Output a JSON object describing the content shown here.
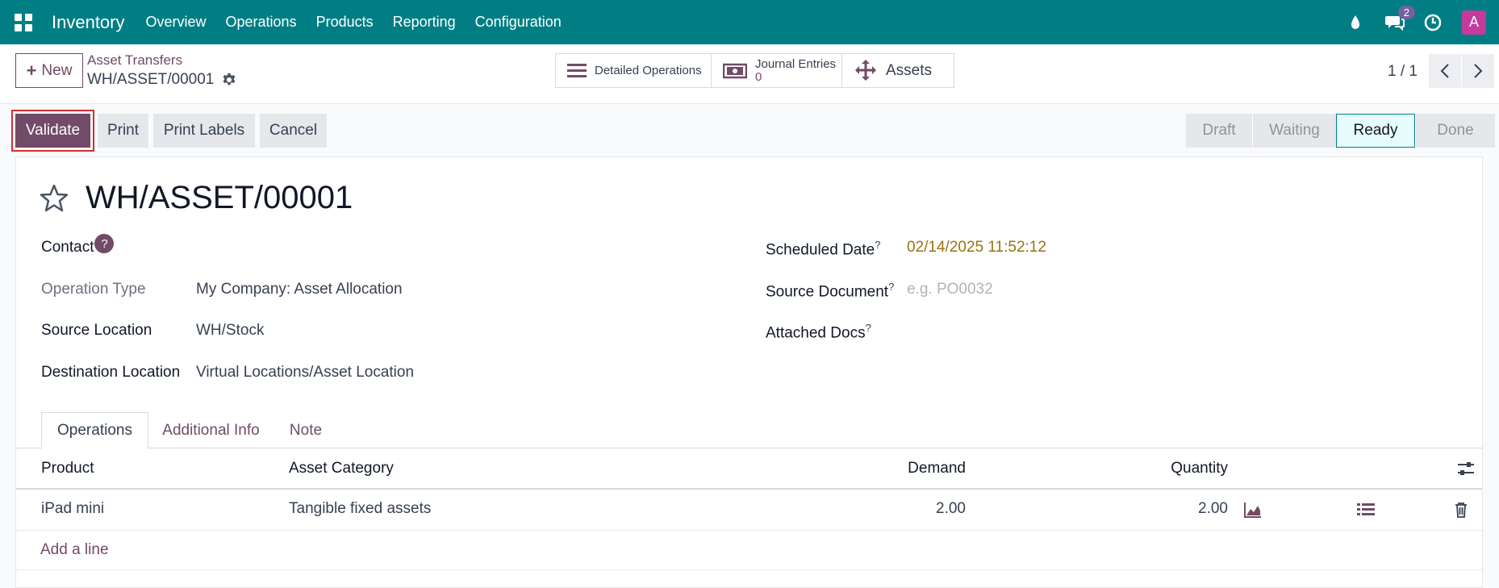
{
  "navbar": {
    "brand": "Inventory",
    "menu": [
      "Overview",
      "Operations",
      "Products",
      "Reporting",
      "Configuration"
    ],
    "messages_count": "2",
    "avatar_letter": "A",
    "icons": [
      "apps-icon",
      "debug-icon",
      "messages-icon",
      "activity-clock-icon"
    ]
  },
  "control_panel": {
    "new_label": "New",
    "breadcrumb_parent": "Asset Transfers",
    "breadcrumb_current": "WH/ASSET/00001",
    "smart_buttons": {
      "detailed_operations": "Detailed Operations",
      "journal_entries_label": "Journal Entries",
      "journal_entries_count": "0",
      "assets": "Assets"
    },
    "pager": "1 / 1"
  },
  "actions": {
    "validate": "Validate",
    "print": "Print",
    "print_labels": "Print Labels",
    "cancel": "Cancel"
  },
  "status_steps": [
    "Draft",
    "Waiting",
    "Ready",
    "Done"
  ],
  "status_active": "Ready",
  "form": {
    "title": "WH/ASSET/00001",
    "contact_label": "Contact",
    "contact_help": "?",
    "operation_type_label": "Operation Type",
    "operation_type_value": "My Company: Asset Allocation",
    "source_location_label": "Source Location",
    "source_location_value": "WH/Stock",
    "destination_location_label": "Destination Location",
    "destination_location_value": "Virtual Locations/Asset Location",
    "scheduled_date_label": "Scheduled Date",
    "scheduled_date_value": "02/14/2025 11:52:12",
    "source_document_label": "Source Document",
    "source_document_placeholder": "e.g. PO0032",
    "attached_docs_label": "Attached Docs",
    "help_mark": "?"
  },
  "tabs": [
    "Operations",
    "Additional Info",
    "Note"
  ],
  "table": {
    "headers": {
      "product": "Product",
      "asset_category": "Asset Category",
      "demand": "Demand",
      "quantity": "Quantity"
    },
    "rows": [
      {
        "product": "iPad mini",
        "asset_category": "Tangible fixed assets",
        "demand": "2.00",
        "quantity": "2.00"
      }
    ],
    "add_line": "Add a line"
  },
  "colors": {
    "navbar": "#017e84",
    "primary": "#714b67",
    "date": "#9a7210"
  }
}
